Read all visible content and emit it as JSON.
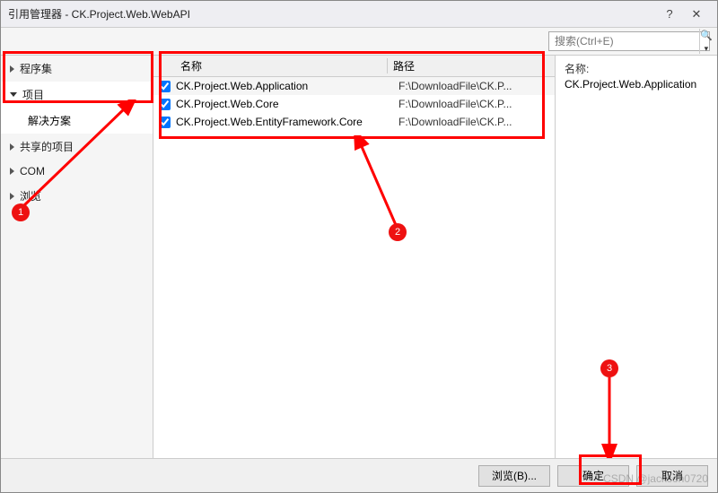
{
  "window": {
    "title": "引用管理器 - CK.Project.Web.WebAPI",
    "help_icon": "?",
    "close_icon": "✕"
  },
  "search": {
    "placeholder": "搜索(Ctrl+E)",
    "icon": "🔍"
  },
  "sidebar": {
    "items": [
      {
        "label": "程序集",
        "expanded": false
      },
      {
        "label": "项目",
        "expanded": true,
        "children": [
          {
            "label": "解决方案"
          }
        ]
      },
      {
        "label": "共享的项目",
        "expanded": false
      },
      {
        "label": "COM",
        "expanded": false
      },
      {
        "label": "浏览",
        "expanded": false
      }
    ]
  },
  "list": {
    "headers": {
      "name": "名称",
      "path": "路径"
    },
    "rows": [
      {
        "checked": true,
        "name": "CK.Project.Web.Application",
        "path": "F:\\DownloadFile\\CK.P..."
      },
      {
        "checked": true,
        "name": "CK.Project.Web.Core",
        "path": "F:\\DownloadFile\\CK.P..."
      },
      {
        "checked": true,
        "name": "CK.Project.Web.EntityFramework.Core",
        "path": "F:\\DownloadFile\\CK.P..."
      }
    ]
  },
  "detail": {
    "name_label": "名称:",
    "name_value": "CK.Project.Web.Application"
  },
  "footer": {
    "browse": "浏览(B)...",
    "ok": "确定",
    "cancel": "取消"
  },
  "watermark": "CSDN @jackson0720",
  "badges": {
    "b1": "1",
    "b2": "2",
    "b3": "3"
  }
}
